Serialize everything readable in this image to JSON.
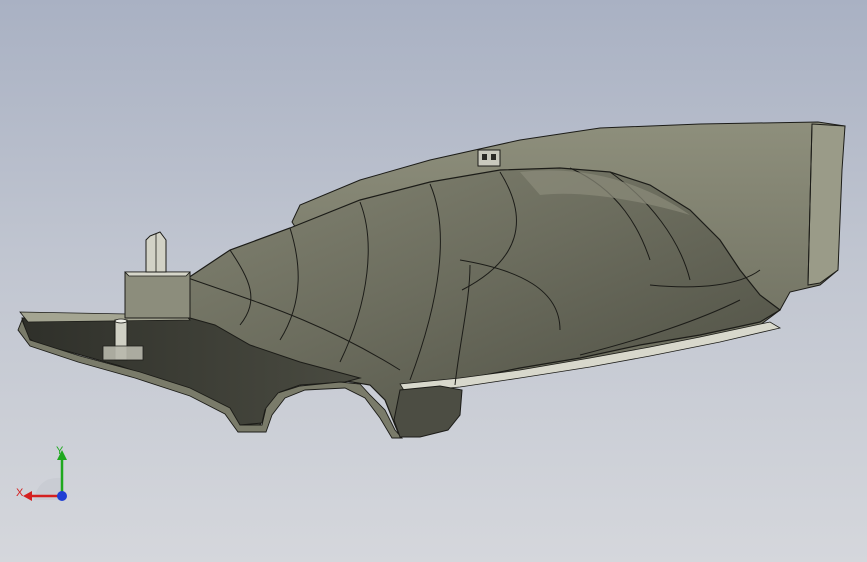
{
  "viewport": {
    "background_top": "#a9b1c3",
    "background_bottom": "#d5d7dc"
  },
  "model": {
    "part_color": "#6f7061",
    "edge_color": "#1c1c18",
    "highlight_color": "#9a9b88",
    "shadow_color": "#3d3e35"
  },
  "triad": {
    "x_label": "X",
    "y_label": "Y",
    "x_color": "#d42020",
    "y_color": "#1fa81f",
    "z_color": "#1f3fd4"
  }
}
